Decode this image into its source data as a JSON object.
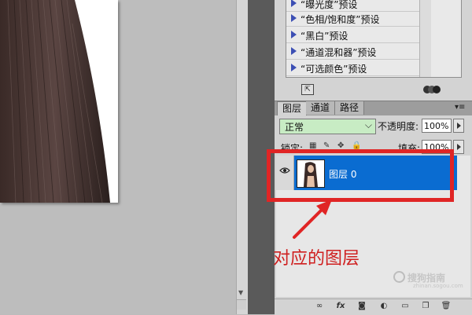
{
  "adjustments": {
    "presets": [
      {
        "label": "“曝光度”预设"
      },
      {
        "label": "“色相/饱和度”预设"
      },
      {
        "label": "“黑白”预设"
      },
      {
        "label": "“通道混和器”预设"
      },
      {
        "label": "“可选颜色”预设"
      }
    ]
  },
  "layers_panel": {
    "tabs": [
      "图层",
      "通道",
      "路径"
    ],
    "blend_mode": "正常",
    "opacity_label": "不透明度:",
    "opacity_value": "100%",
    "lock_label": "锁定:",
    "fill_label": "填充:",
    "fill_value": "100%",
    "layers": [
      {
        "name": "图层 0",
        "visible": true,
        "selected": true
      }
    ],
    "toolbar_icons": [
      "link-icon",
      "fx-icon",
      "mask-icon",
      "adjustment-icon",
      "group-folder-icon",
      "new-layer-icon",
      "trash-icon"
    ]
  },
  "annotation": {
    "text": "对应的图层",
    "color": "#cf1f1f"
  },
  "watermark": {
    "text": "搜狗指南",
    "sub": "zhinan.sogou.com"
  },
  "colors": {
    "selected_layer": "#0a6cd1",
    "highlight": "#e02525",
    "blend_field": "#c8ecc4"
  }
}
